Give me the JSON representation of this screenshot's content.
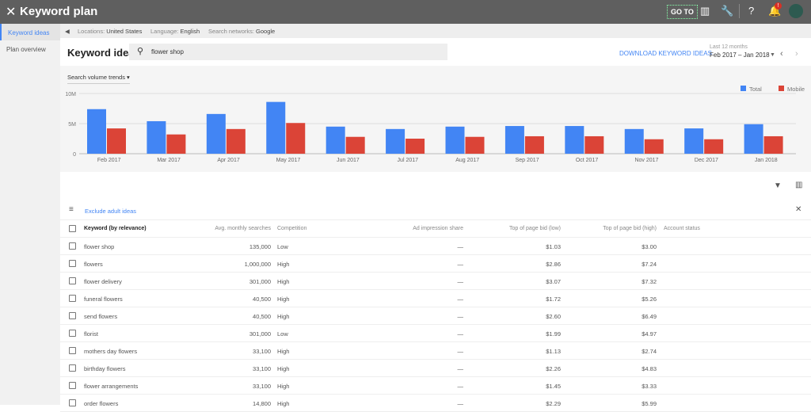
{
  "topbar": {
    "title": "Keyword plan",
    "goto": "GO TO",
    "notification_count": "!"
  },
  "sidebar": {
    "items": [
      {
        "label": "Keyword ideas",
        "active": true
      },
      {
        "label": "Plan overview",
        "active": false
      }
    ]
  },
  "filters": {
    "locations_label": "Locations:",
    "locations": "United States",
    "language_label": "Language:",
    "language": "English",
    "networks_label": "Search networks:",
    "networks": "Google"
  },
  "header": {
    "title": "Keyword ideas",
    "search_value": "flower shop",
    "download": "DOWNLOAD KEYWORD IDEAS",
    "range_label": "Last 12 months",
    "range": "Feb 2017 – Jan 2018"
  },
  "chart_data": {
    "type": "bar",
    "title": "Search volume trends",
    "categories": [
      "Feb 2017",
      "Mar 2017",
      "Apr 2017",
      "May 2017",
      "Jun 2017",
      "Jul 2017",
      "Aug 2017",
      "Sep 2017",
      "Oct 2017",
      "Nov 2017",
      "Dec 2017",
      "Jan 2018"
    ],
    "series": [
      {
        "name": "Total",
        "color": "#4285f4",
        "values": [
          7400000,
          5400000,
          6600000,
          8600000,
          4500000,
          4100000,
          4500000,
          4600000,
          4600000,
          4100000,
          4200000,
          4900000
        ]
      },
      {
        "name": "Mobile",
        "color": "#db4437",
        "values": [
          4200000,
          3200000,
          4100000,
          5100000,
          2800000,
          2500000,
          2800000,
          2900000,
          2900000,
          2400000,
          2400000,
          2900000
        ]
      }
    ],
    "ylim": [
      0,
      10000000
    ],
    "yticks": [
      "0",
      "5M",
      "10M"
    ],
    "grid": true,
    "legend": "top-right"
  },
  "table": {
    "exclude_label": "Exclude adult ideas",
    "headers": [
      "Keyword (by relevance)",
      "Avg. monthly searches",
      "Competition",
      "Ad impression share",
      "Top of page bid (low)",
      "Top of page bid (high)",
      "Account status"
    ],
    "rows": [
      [
        "flower shop",
        "135,000",
        "Low",
        "—",
        "$1.03",
        "$3.00"
      ],
      [
        "flowers",
        "1,000,000",
        "High",
        "—",
        "$2.86",
        "$7.24"
      ],
      [
        "flower delivery",
        "301,000",
        "High",
        "—",
        "$3.07",
        "$7.32"
      ],
      [
        "funeral flowers",
        "40,500",
        "High",
        "—",
        "$1.72",
        "$5.26"
      ],
      [
        "send flowers",
        "40,500",
        "High",
        "—",
        "$2.60",
        "$6.49"
      ],
      [
        "florist",
        "301,000",
        "Low",
        "—",
        "$1.99",
        "$4.97"
      ],
      [
        "mothers day flowers",
        "33,100",
        "High",
        "—",
        "$1.13",
        "$2.74"
      ],
      [
        "birthday flowers",
        "33,100",
        "High",
        "—",
        "$2.26",
        "$4.83"
      ],
      [
        "flower arrangements",
        "33,100",
        "High",
        "—",
        "$1.45",
        "$3.33"
      ],
      [
        "order flowers",
        "14,800",
        "High",
        "—",
        "$2.29",
        "$5.99"
      ]
    ]
  }
}
